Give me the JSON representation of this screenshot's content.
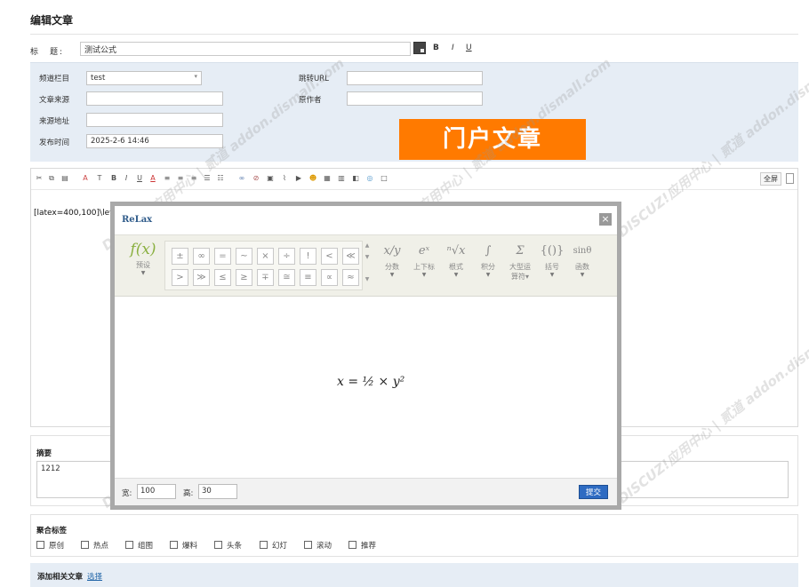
{
  "page": {
    "title": "编辑文章"
  },
  "title_row": {
    "label": "标　题:",
    "value": "测试公式",
    "bold": "B",
    "italic": "I",
    "underline": "U"
  },
  "meta": {
    "channel_label": "频道栏目",
    "channel_value": "test",
    "redirect_label": "跳转URL",
    "source_label": "文章来源",
    "author_label": "原作者",
    "source_url_label": "来源地址",
    "publish_label": "发布时间",
    "publish_value": "2025-2-6 14:46"
  },
  "badge": "门户文章",
  "editor": {
    "content": "[latex=400,100]\\left",
    "fullscreen_label": "全屏"
  },
  "summary": {
    "label": "摘要",
    "value": "1212"
  },
  "tags": {
    "label": "聚合标签",
    "items": [
      "原创",
      "热点",
      "组图",
      "爆料",
      "头条",
      "幻灯",
      "滚动",
      "推荐"
    ]
  },
  "related": {
    "label": "添加相关文章",
    "link": "选择"
  },
  "dialog": {
    "title": "ReLax",
    "close": "×",
    "preset_icon": "f(x)",
    "preset_label": "预设",
    "symbols_row1": [
      "±",
      "∞",
      "=",
      "~",
      "×",
      "÷",
      "!",
      "<",
      "≪"
    ],
    "symbols_row2": [
      ">",
      "≫",
      "≤",
      "≥",
      "∓",
      "≅",
      "≡",
      "∝",
      "≈"
    ],
    "categories": [
      {
        "icon": "x/y",
        "label": "分数"
      },
      {
        "icon": "eˣ",
        "label": "上下标"
      },
      {
        "icon": "ⁿ√x",
        "label": "根式"
      },
      {
        "icon": "∫",
        "label": "积分"
      },
      {
        "icon": "Σ",
        "label": "大型运算符▾"
      },
      {
        "icon": "{()}",
        "label": "括号"
      },
      {
        "icon": "sinθ",
        "label": "函数"
      }
    ],
    "formula": "x = ½ × y²",
    "width_label": "宽:",
    "width_value": "100",
    "height_label": "高:",
    "height_value": "30",
    "submit": "提交"
  },
  "watermark": "DISCUZ!应用中心 | 贰道 addon.dismall.com",
  "colors": {
    "accent_orange": "#ff7a00",
    "panel_blue": "#e6edf5",
    "link_blue": "#2366a8",
    "submit_blue": "#2e6bc2"
  }
}
